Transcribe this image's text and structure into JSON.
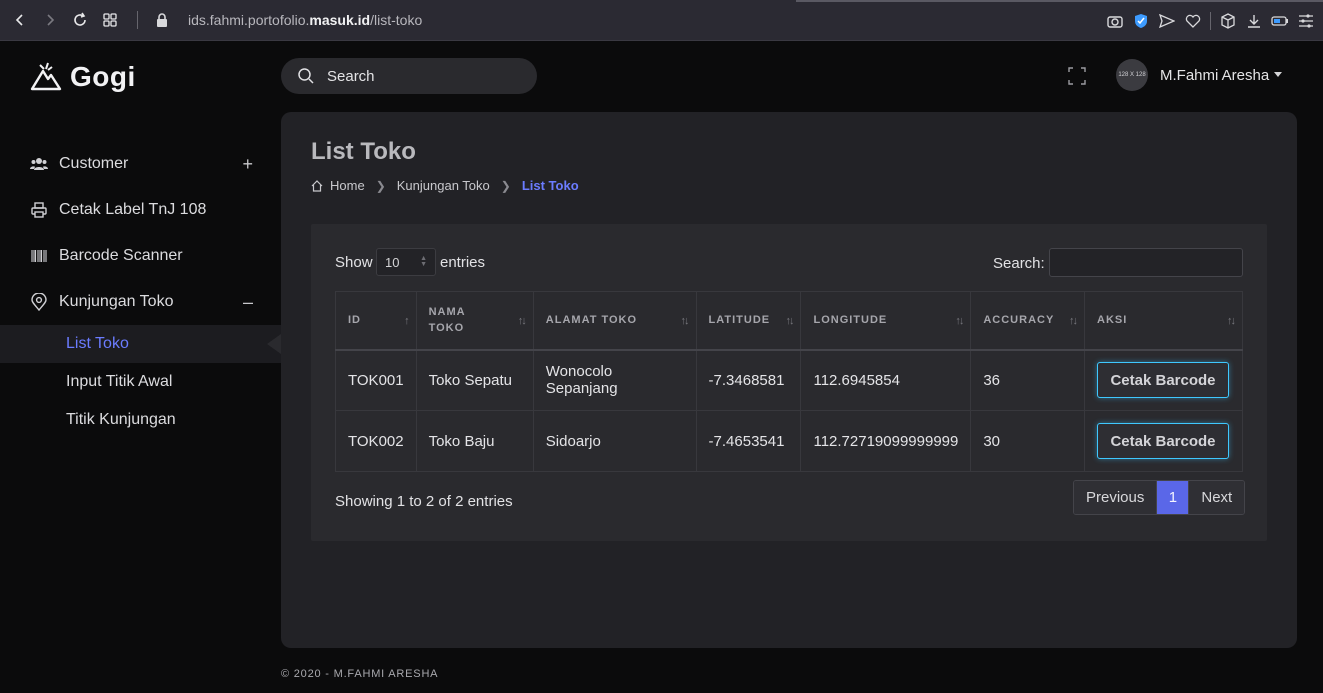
{
  "browser": {
    "url_prefix": "ids.fahmi.portofolio.",
    "url_domain": "masuk.id",
    "url_path": "/list-toko"
  },
  "brand": {
    "name": "Gogi"
  },
  "sidebar": {
    "items": [
      {
        "label": "Customer",
        "icon": "users-icon",
        "toggle": "+"
      },
      {
        "label": "Cetak Label TnJ 108",
        "icon": "printer-icon"
      },
      {
        "label": "Barcode Scanner",
        "icon": "barcode-icon"
      },
      {
        "label": "Kunjungan Toko",
        "icon": "map-pin-icon",
        "toggle": "–"
      }
    ],
    "subitems": [
      {
        "label": "List Toko",
        "active": true
      },
      {
        "label": "Input Titik Awal"
      },
      {
        "label": "Titik Kunjungan"
      }
    ]
  },
  "header": {
    "search_placeholder": "Search",
    "avatar_text": "128 X 128",
    "user_name": "M.Fahmi Aresha"
  },
  "page": {
    "title": "List Toko",
    "breadcrumb": [
      "Home",
      "Kunjungan Toko",
      "List Toko"
    ]
  },
  "table_controls": {
    "show_label": "Show",
    "page_length": "10",
    "entries_label": "entries",
    "search_label": "Search:"
  },
  "table": {
    "columns": [
      "ID",
      "NAMA TOKO",
      "ALAMAT TOKO",
      "LATITUDE",
      "LONGITUDE",
      "ACCURACY",
      "AKSI"
    ],
    "rows": [
      {
        "id": "TOK001",
        "nama": "Toko Sepatu",
        "alamat": "Wonocolo Sepanjang",
        "lat": "-7.3468581",
        "lng": "112.6945854",
        "acc": "36",
        "action": "Cetak Barcode"
      },
      {
        "id": "TOK002",
        "nama": "Toko Baju",
        "alamat": "Sidoarjo",
        "lat": "-7.4653541",
        "lng": "112.72719099999999",
        "acc": "30",
        "action": "Cetak Barcode"
      }
    ]
  },
  "pagination": {
    "info": "Showing 1 to 2 of 2 entries",
    "previous": "Previous",
    "current": "1",
    "next": "Next"
  },
  "footer": {
    "text": "© 2020 - M.FAHMI ARESHA"
  },
  "colors": {
    "accent": "#6b7cff",
    "button_border": "#3fc8ff",
    "page_active": "#5a67e8"
  }
}
